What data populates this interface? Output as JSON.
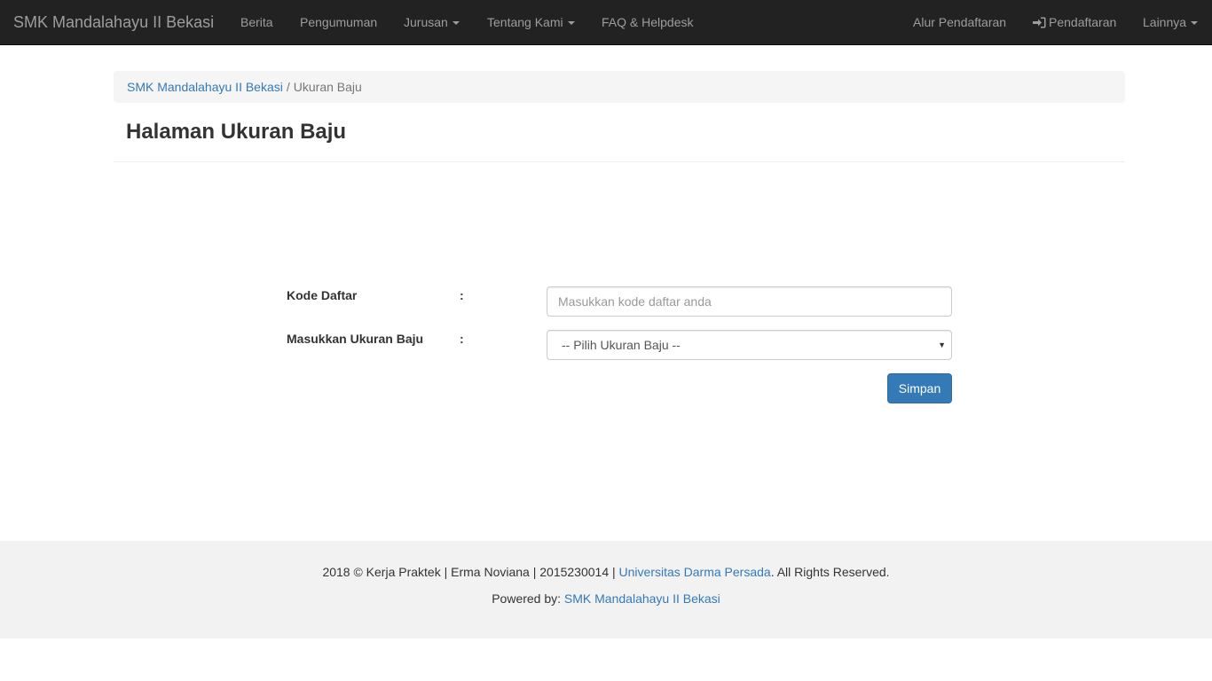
{
  "navbar": {
    "brand": "SMK Mandalahayu II Bekasi",
    "items": [
      {
        "label": "Berita"
      },
      {
        "label": "Pengumuman"
      },
      {
        "label": "Jurusan"
      },
      {
        "label": "Tentang Kami"
      },
      {
        "label": "FAQ & Helpdesk"
      }
    ],
    "right_items": [
      {
        "label": "Alur Pendaftaran"
      },
      {
        "label": "Pendaftaran",
        "icon": "login-icon"
      },
      {
        "label": "Lainnya"
      }
    ]
  },
  "breadcrumb": {
    "home": "SMK Mandalahayu II Bekasi",
    "separator": "/",
    "current": "Ukuran Baju"
  },
  "page": {
    "title": "Halaman Ukuran Baju"
  },
  "form": {
    "kode_label": "Kode Daftar",
    "colon": ":",
    "kode_value": "",
    "kode_placeholder": "Masukkan kode daftar anda",
    "ukuran_label": "Masukkan Ukuran Baju",
    "ukuran_selected": "-- Pilih Ukuran Baju --",
    "submit_label": "Simpan"
  },
  "footer": {
    "line1_prefix": "2018 © Kerja Praktek | Erma Noviana | 2015230014 |",
    "line1_link": "Universitas Darma Persada",
    "line1_suffix": ". All Rights Reserved.",
    "line2_prefix": "Powered by:",
    "line2_link": "SMK Mandalahayu II Bekasi"
  },
  "colors": {
    "navbar_bg": "#222222",
    "nav_text": "#9d9d9d",
    "link": "#337ab7",
    "button_primary": "#337ab7",
    "footer_bg": "#f2f2f2"
  }
}
